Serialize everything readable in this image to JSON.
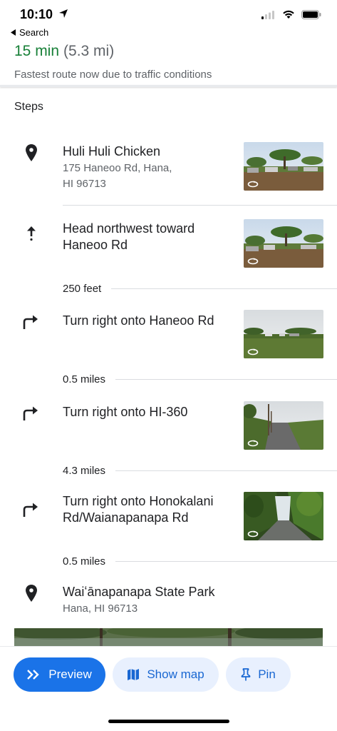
{
  "status_bar": {
    "time": "10:10",
    "back_label": "Search"
  },
  "route": {
    "eta": "15 min",
    "distance": "(5.3 mi)",
    "note": "Fastest route now due to traffic conditions"
  },
  "steps_title": "Steps",
  "steps": [
    {
      "icon": "pin-icon",
      "title": "Huli Huli Chicken",
      "sub_line1": "175 Haneoo Rd, Hana,",
      "sub_line2": "HI 96713"
    },
    {
      "icon": "straight-arrow-icon",
      "title_line1": "Head northwest toward",
      "title_line2": "Haneoo Rd",
      "distance": "250 feet"
    },
    {
      "icon": "turn-right-icon",
      "title": "Turn right onto Haneoo Rd",
      "distance": "0.5 miles"
    },
    {
      "icon": "turn-right-icon",
      "title": "Turn right onto HI-360",
      "distance": "4.3 miles"
    },
    {
      "icon": "turn-right-icon",
      "title_line1": "Turn right onto Honokalani",
      "title_line2": "Rd/Waianapanapa Rd",
      "distance": "0.5 miles"
    },
    {
      "icon": "pin-icon",
      "title": "Waiʻānapanapa State Park",
      "sub_line1": "Hana, HI 96713"
    }
  ],
  "actions": {
    "preview": "Preview",
    "show_map": "Show map",
    "pin": "Pin"
  },
  "colors": {
    "accent": "#1a73e8",
    "eta_green": "#188038",
    "chip_bg": "#e8f0fe"
  }
}
